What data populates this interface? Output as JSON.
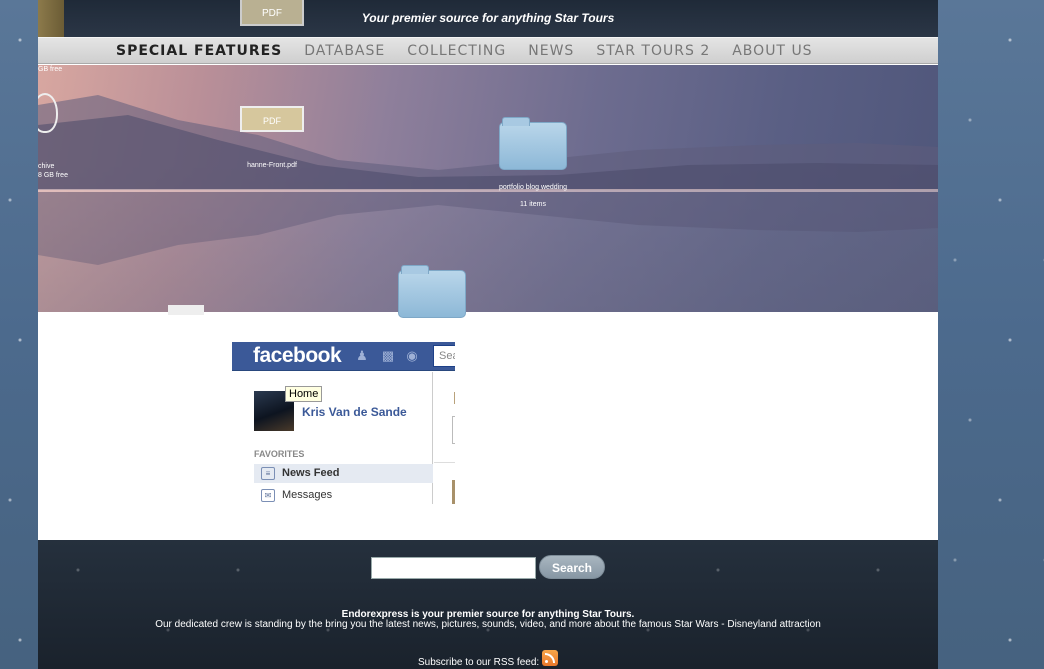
{
  "header": {
    "tagline": "Your premier source for anything Star Tours",
    "pdf_label": "PDF"
  },
  "nav": {
    "items": [
      {
        "label": "Special Features",
        "active": true
      },
      {
        "label": "Database"
      },
      {
        "label": "Collecting"
      },
      {
        "label": "News"
      },
      {
        "label": "Star Tours 2"
      },
      {
        "label": "About Us"
      }
    ]
  },
  "hero": {
    "icons": {
      "pdf_label": "PDF",
      "pdf_file": "hanne-Front.pdf",
      "folder_name": "portfolio blog wedding",
      "folder_count": "11 items",
      "drive_name": "chive",
      "drive_free": "8 GB free",
      "top_drive_free": "GB free"
    }
  },
  "facebook": {
    "logo": "facebook",
    "search_placeholder": "Sea",
    "tooltip": "Home",
    "user_name": "Kris Van de Sande",
    "favorites_heading": "FAVORITES",
    "items": [
      {
        "label": "News Feed",
        "selected": true
      },
      {
        "label": "Messages"
      }
    ]
  },
  "footer": {
    "search_button": "Search",
    "line1": "Endorexpress is your premier source for anything Star Tours.",
    "line2": "Our dedicated crew is standing by the bring you the latest news, pictures, sounds, video, and more about the famous Star Wars - Disneyland attraction",
    "rss_text": "Subscribe to our RSS feed:"
  }
}
